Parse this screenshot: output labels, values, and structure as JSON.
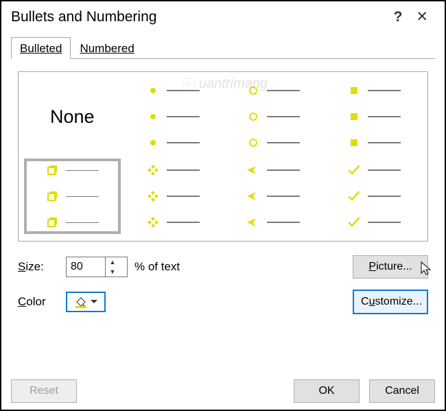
{
  "title": "Bullets and Numbering",
  "tabs": {
    "bulleted": "Bulleted",
    "numbered": "Numbered"
  },
  "cells": {
    "none": "None"
  },
  "size": {
    "label": "Size:",
    "value": "80",
    "suffix": "% of text"
  },
  "color": {
    "label": "Color",
    "hex": "#e0dd00"
  },
  "buttons": {
    "picture": "Picture...",
    "customize": "Customize...",
    "reset": "Reset",
    "ok": "OK",
    "cancel": "Cancel"
  },
  "titlebar": {
    "help": "?",
    "close": "✕"
  },
  "watermark": "uantrimang"
}
